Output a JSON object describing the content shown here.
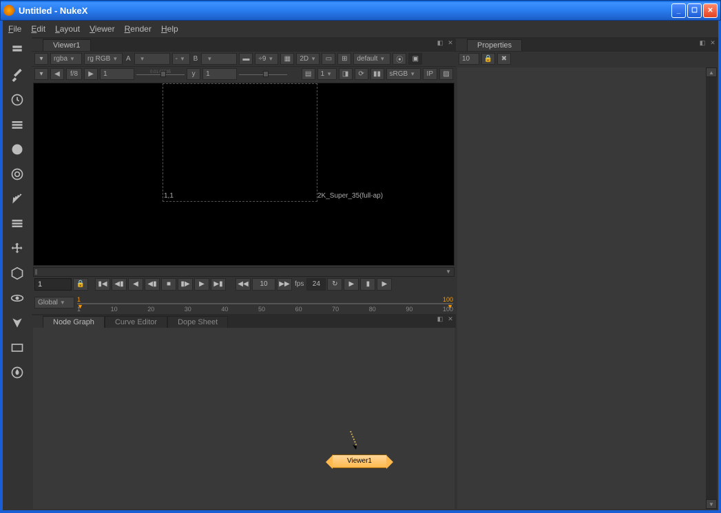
{
  "window": {
    "title": "Untitled - NukeX"
  },
  "menu": {
    "file": "File",
    "edit": "Edit",
    "layout": "Layout",
    "viewer": "Viewer",
    "render": "Render",
    "help": "Help"
  },
  "viewer": {
    "tab": "Viewer1",
    "row1": {
      "channel": "rgba",
      "rgb": "rg RGB",
      "a": "A",
      "dash": "-",
      "b": "B",
      "downscale": "÷9",
      "mode": "2D",
      "default": "default"
    },
    "row2": {
      "fstop": "f/8",
      "gain": "1",
      "gainticks": "0.01 65535",
      "gamma_label": "y",
      "gamma": "1",
      "layer": "1",
      "colorspace": "sRGB",
      "ip": "IP"
    },
    "viewport": {
      "coords": "1,1",
      "format": "2K_Super_35(full-ap)"
    },
    "playback": {
      "frame_in": "1",
      "frame": "10",
      "fps_label": "fps",
      "fps": "24"
    },
    "timeline": {
      "mode": "Global",
      "start": "1",
      "end": "100",
      "ticks": [
        "1",
        "10",
        "20",
        "30",
        "40",
        "50",
        "60",
        "70",
        "80",
        "90",
        "100"
      ]
    }
  },
  "nodegraph": {
    "tabs": {
      "ng": "Node Graph",
      "ce": "Curve Editor",
      "ds": "Dope Sheet"
    },
    "node": "Viewer1"
  },
  "properties": {
    "tab": "Properties",
    "count": "10"
  }
}
